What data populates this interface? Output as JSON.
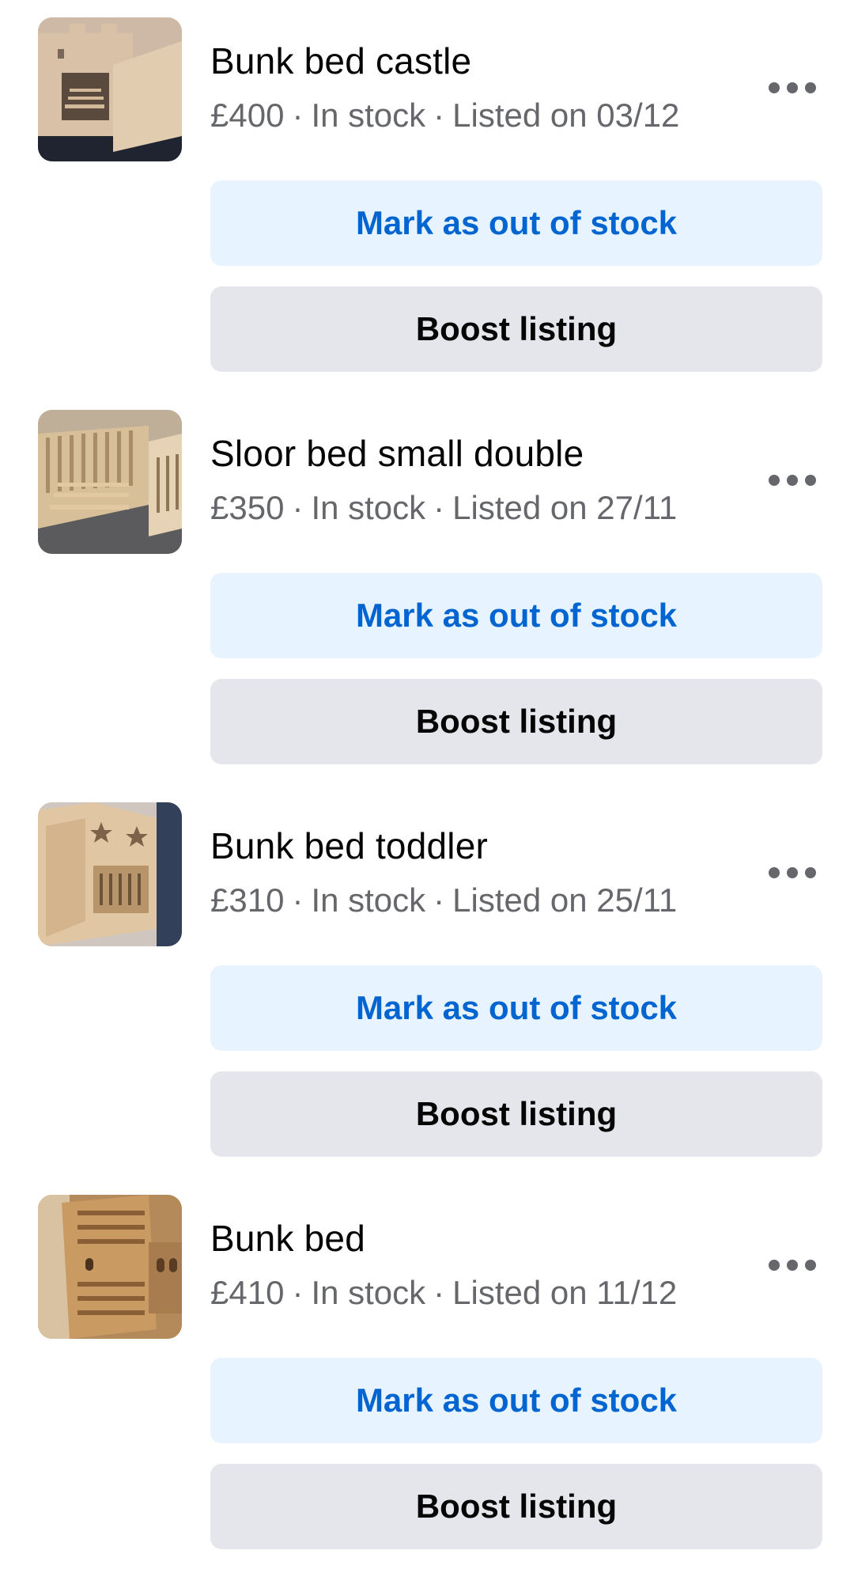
{
  "listings": [
    {
      "title": "Bunk bed castle",
      "price": "£400",
      "status": "In stock",
      "listed": "Listed on 03/12",
      "thumbnail": "bunk-bed-castle-photo",
      "mark_label": "Mark as out of stock",
      "boost_label": "Boost listing"
    },
    {
      "title": "Sloor bed small double",
      "price": "£350",
      "status": "In stock",
      "listed": "Listed on 27/11",
      "thumbnail": "floor-bed-photo",
      "mark_label": "Mark as out of stock",
      "boost_label": "Boost listing"
    },
    {
      "title": "Bunk bed toddler",
      "price": "£310",
      "status": "In stock",
      "listed": "Listed on 25/11",
      "thumbnail": "toddler-bunk-bed-photo",
      "mark_label": "Mark as out of stock",
      "boost_label": "Boost listing"
    },
    {
      "title": "Bunk bed",
      "price": "£410",
      "status": "In stock",
      "listed": "Listed on 11/12",
      "thumbnail": "bunk-bed-photo",
      "mark_label": "Mark as out of stock",
      "boost_label": "Boost listing"
    }
  ],
  "more_icon": "more-options-icon",
  "separator": "·",
  "colors": {
    "primary_blue": "#0064d1",
    "mark_button_bg": "#e7f3ff",
    "boost_button_bg": "#e4e6eb",
    "secondary_text": "#65676b",
    "primary_text": "#050505"
  }
}
